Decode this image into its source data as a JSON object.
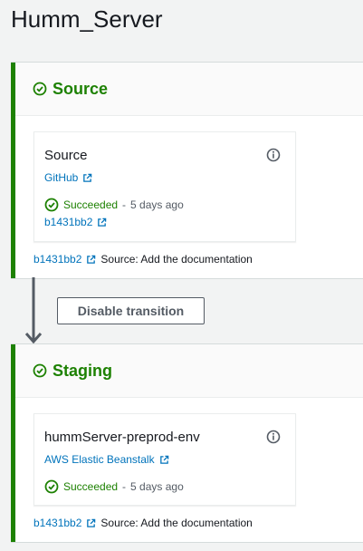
{
  "page": {
    "title": "Humm_Server"
  },
  "colors": {
    "success": "#1d8102",
    "link": "#0073bb",
    "muted": "#545b64",
    "stage_bar": "#1d8102"
  },
  "stages": [
    {
      "title": "Source",
      "status_icon": "check-circle-icon",
      "action": {
        "name": "Source",
        "provider": "GitHub",
        "status": "Succeeded",
        "separator": "-",
        "time": "5 days ago",
        "commit": "b1431bb2"
      },
      "footer": {
        "commit": "b1431bb2",
        "message": "Source: Add the documentation"
      }
    },
    {
      "title": "Staging",
      "status_icon": "check-circle-icon",
      "action": {
        "name": "hummServer-preprod-env",
        "provider": "AWS Elastic Beanstalk",
        "status": "Succeeded",
        "separator": "-",
        "time": "5 days ago"
      },
      "footer": {
        "commit": "b1431bb2",
        "message": "Source: Add the documentation"
      }
    }
  ],
  "transition": {
    "button_label": "Disable transition"
  }
}
